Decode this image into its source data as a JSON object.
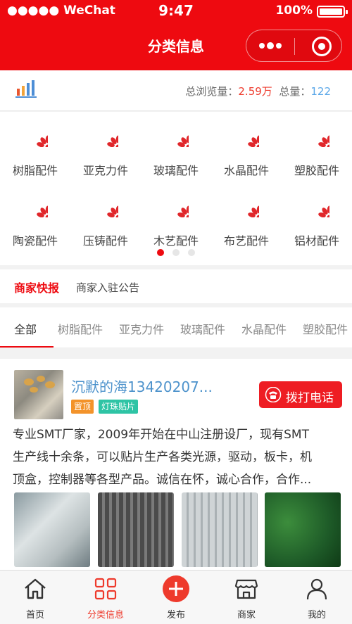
{
  "status_bar": {
    "carrier": "●●●●● WeChat",
    "time": "9:47",
    "battery_text": "100%",
    "battery_level": 1.0
  },
  "nav": {
    "title": "分类信息"
  },
  "stats": {
    "total_views_label": "总浏览量：",
    "total_views_value": "2.59万",
    "total_label": "总量：",
    "total_value": "122"
  },
  "categories": [
    {
      "label": "树脂配件"
    },
    {
      "label": "亚克力件"
    },
    {
      "label": "玻璃配件"
    },
    {
      "label": "水晶配件"
    },
    {
      "label": "塑胶配件"
    },
    {
      "label": "陶瓷配件"
    },
    {
      "label": "压铸配件"
    },
    {
      "label": "木艺配件"
    },
    {
      "label": "布艺配件"
    },
    {
      "label": "铝材配件"
    }
  ],
  "carousel": {
    "pages": 3,
    "active": 0
  },
  "notice": {
    "tag": "商家快报",
    "text": "商家入驻公告"
  },
  "tabs": [
    {
      "label": "全部"
    },
    {
      "label": "树脂配件"
    },
    {
      "label": "亚克力件"
    },
    {
      "label": "玻璃配件"
    },
    {
      "label": "水晶配件"
    },
    {
      "label": "塑胶配件"
    }
  ],
  "post": {
    "name": "沉默的海13420207...",
    "badge_top": "置顶",
    "badge_category": "灯珠贴片",
    "call_label": "拨打电话",
    "description_lines": [
      "专业SMT厂家，2009年开始在中山注册设厂，现有SMT",
      "生产线十余条，可以贴片生产各类光源，驱动，板卡，机",
      "顶盒，控制器等各型产品。诚信在怀，诚心合作，合作..."
    ]
  },
  "tabbar": [
    {
      "label": "首页",
      "icon": "home-icon"
    },
    {
      "label": "分类信息",
      "icon": "category-grid-icon"
    },
    {
      "label": "发布",
      "icon": "publish-plus-icon"
    },
    {
      "label": "商家",
      "icon": "shop-icon"
    },
    {
      "label": "我的",
      "icon": "user-icon"
    }
  ],
  "colors": {
    "brand_red": "#ee0a10",
    "views_value": "#ee3a2c",
    "total_value": "#5aa7e8",
    "name_blue": "#4e93cc",
    "badge_orange": "#f3932a",
    "badge_teal": "#2ec4a5"
  }
}
